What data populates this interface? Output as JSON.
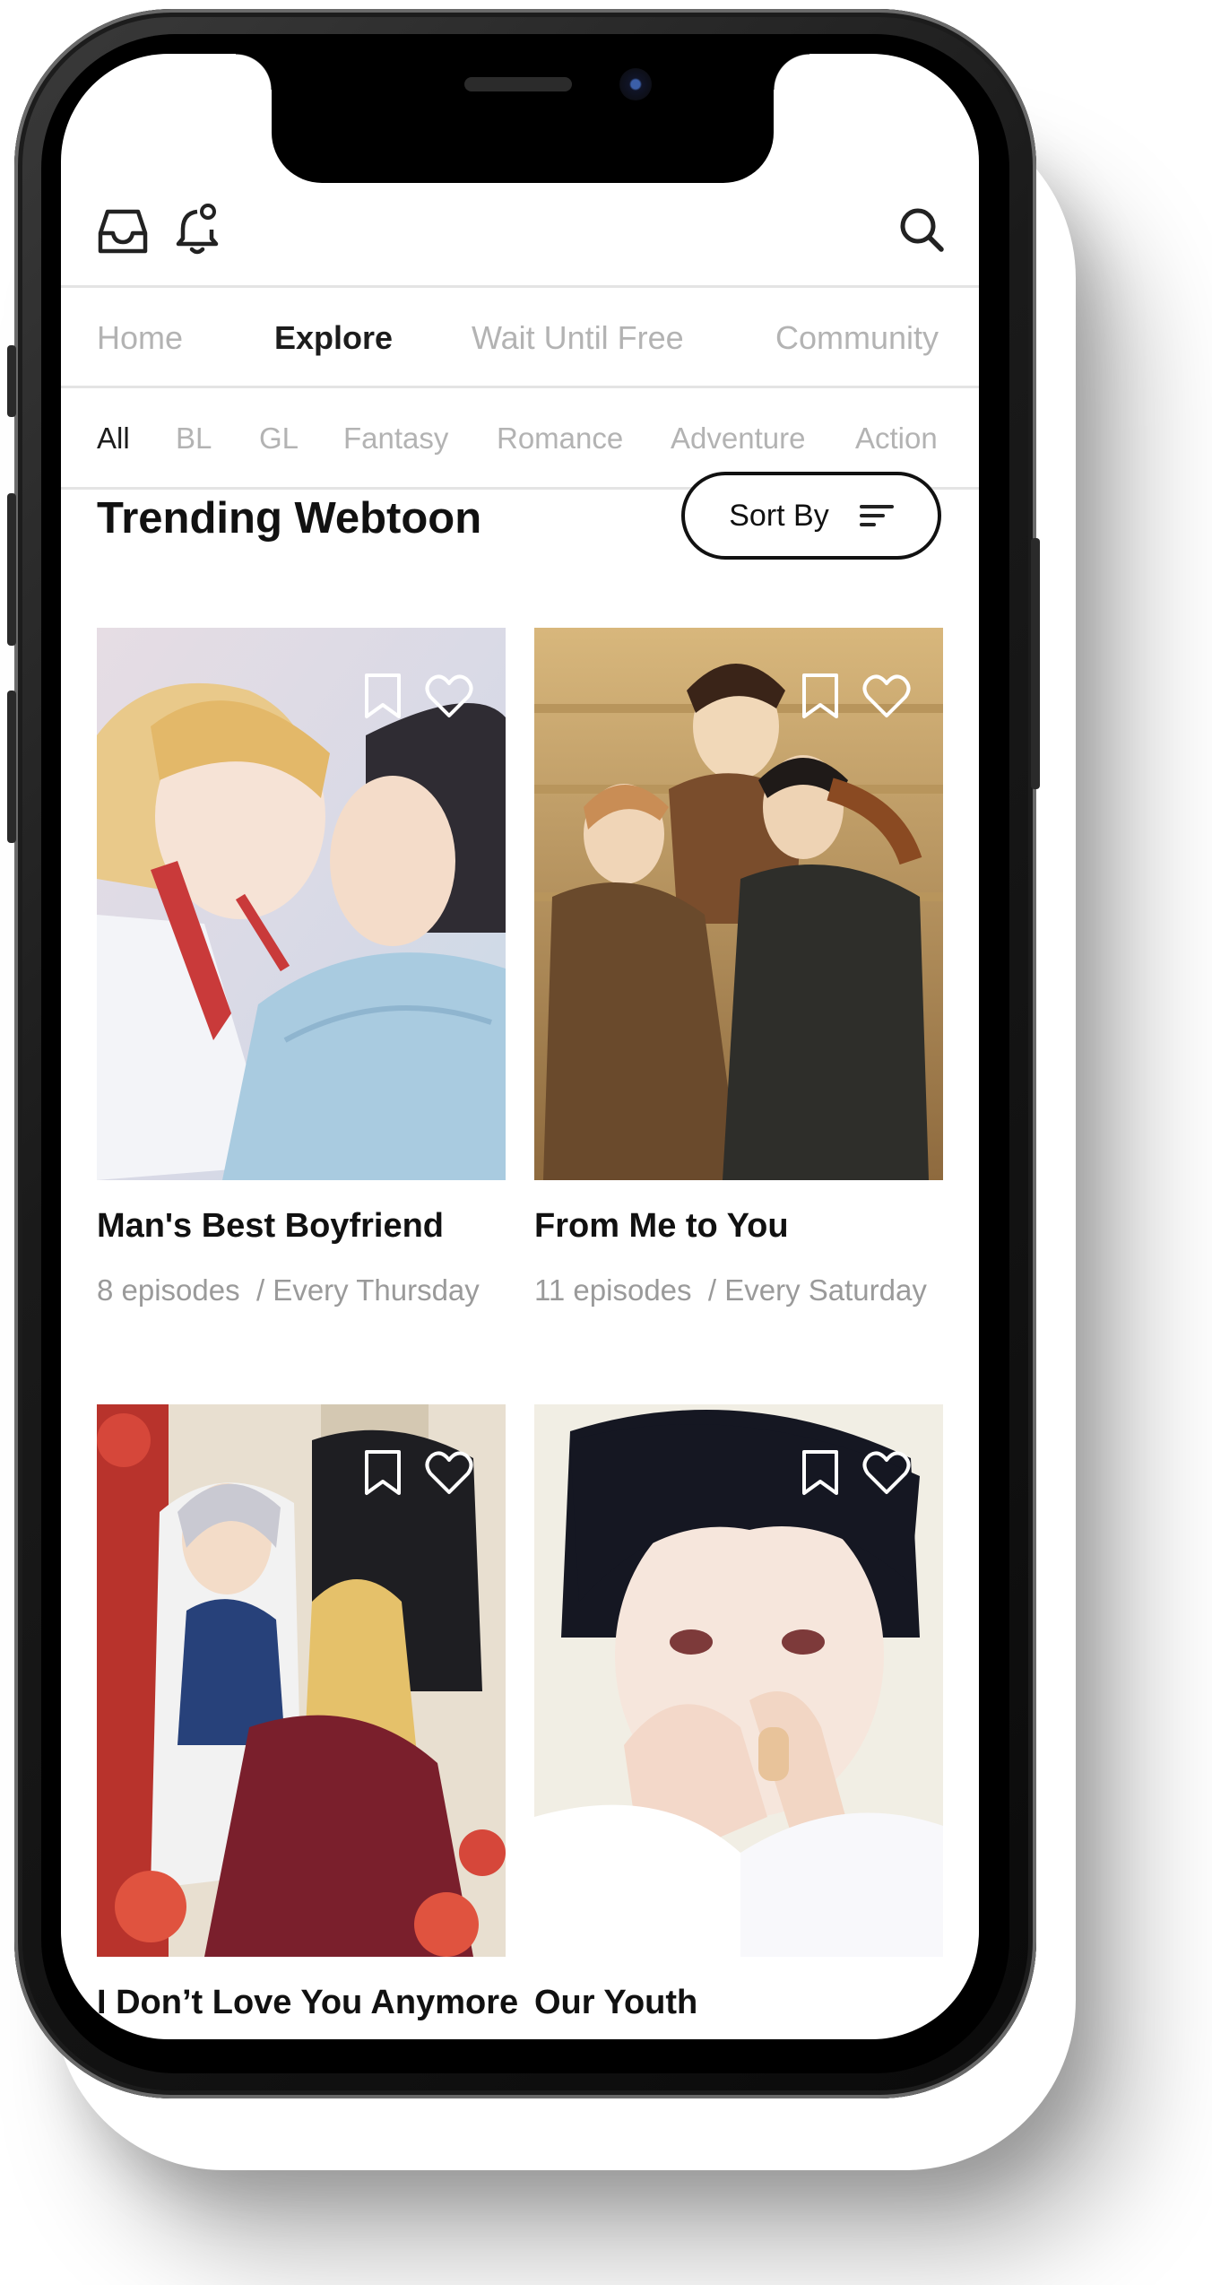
{
  "header": {
    "icons": [
      "inbox-icon",
      "notification-bell-icon",
      "search-icon"
    ]
  },
  "tabs": [
    {
      "label": "Home",
      "active": false
    },
    {
      "label": "Explore",
      "active": true
    },
    {
      "label": "Wait Until Free",
      "active": false
    },
    {
      "label": "Community",
      "active": false
    }
  ],
  "genres": [
    {
      "label": "All",
      "active": true
    },
    {
      "label": "BL",
      "active": false
    },
    {
      "label": "GL",
      "active": false
    },
    {
      "label": "Fantasy",
      "active": false
    },
    {
      "label": "Romance",
      "active": false
    },
    {
      "label": "Adventure",
      "active": false
    },
    {
      "label": "Action",
      "active": false
    }
  ],
  "section": {
    "title": "Trending Webtoon",
    "sort_label": "Sort By"
  },
  "webtoons": [
    {
      "title": "Man's Best Boyfriend",
      "episodes": "8 episodes",
      "schedule": "/ Every Thursday"
    },
    {
      "title": "From Me to You",
      "episodes": "11 episodes",
      "schedule": "/ Every Saturday"
    },
    {
      "title": "I Don’t Love You Anymore",
      "episodes": "",
      "schedule": ""
    },
    {
      "title": "Our Youth",
      "episodes": "",
      "schedule": ""
    }
  ],
  "colors": {
    "active_text": "#1c1c1c",
    "inactive_text": "#b3b3b3",
    "meta_text": "#9a9a9a"
  }
}
